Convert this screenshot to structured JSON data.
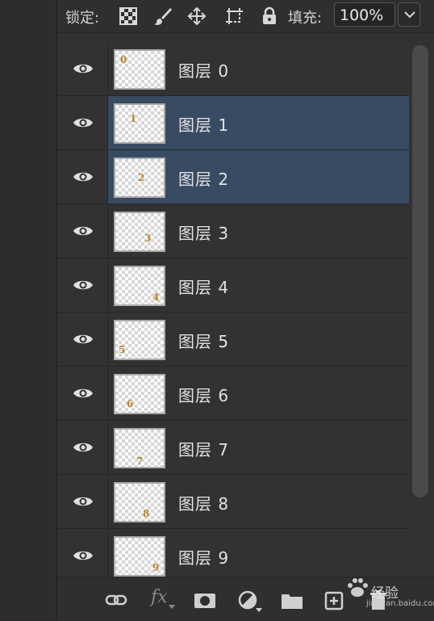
{
  "lockbar": {
    "lock_label": "锁定:",
    "fill_label": "填充:",
    "fill_value": "100%"
  },
  "icons": {
    "lock_transparent": "checkerboard-lock-icon",
    "lock_paint": "brush-icon",
    "lock_position": "move-arrows-icon",
    "lock_artboard": "artboard-icon",
    "lock_all": "padlock-icon",
    "fill_dropdown": "chevron-down-icon",
    "visibility": "eye-icon"
  },
  "layers": [
    {
      "name": "图层 0",
      "digit": "0",
      "selected": false
    },
    {
      "name": "图层 1",
      "digit": "1",
      "selected": true
    },
    {
      "name": "图层 2",
      "digit": "2",
      "selected": true
    },
    {
      "name": "图层 3",
      "digit": "3",
      "selected": false
    },
    {
      "name": "图层 4",
      "digit": "4",
      "selected": false
    },
    {
      "name": "图层 5",
      "digit": "5",
      "selected": false
    },
    {
      "name": "图层 6",
      "digit": "6",
      "selected": false
    },
    {
      "name": "图层 7",
      "digit": "7",
      "selected": false
    },
    {
      "name": "图层 8",
      "digit": "8",
      "selected": false
    },
    {
      "name": "图层 9",
      "digit": "9",
      "selected": false
    }
  ],
  "bottombar": {
    "fx_label": "fx",
    "icons": [
      "link-layers-icon",
      "fx-icon",
      "mask-icon",
      "adjustment-icon",
      "folder-icon",
      "new-layer-icon",
      "trash-icon"
    ]
  },
  "watermark": {
    "text": "经验",
    "url": "jingyan.baidu.com"
  },
  "colors": {
    "panel_bg": "#323232",
    "selected_row": "#384b62",
    "thumb_digit": "#b8862b"
  }
}
